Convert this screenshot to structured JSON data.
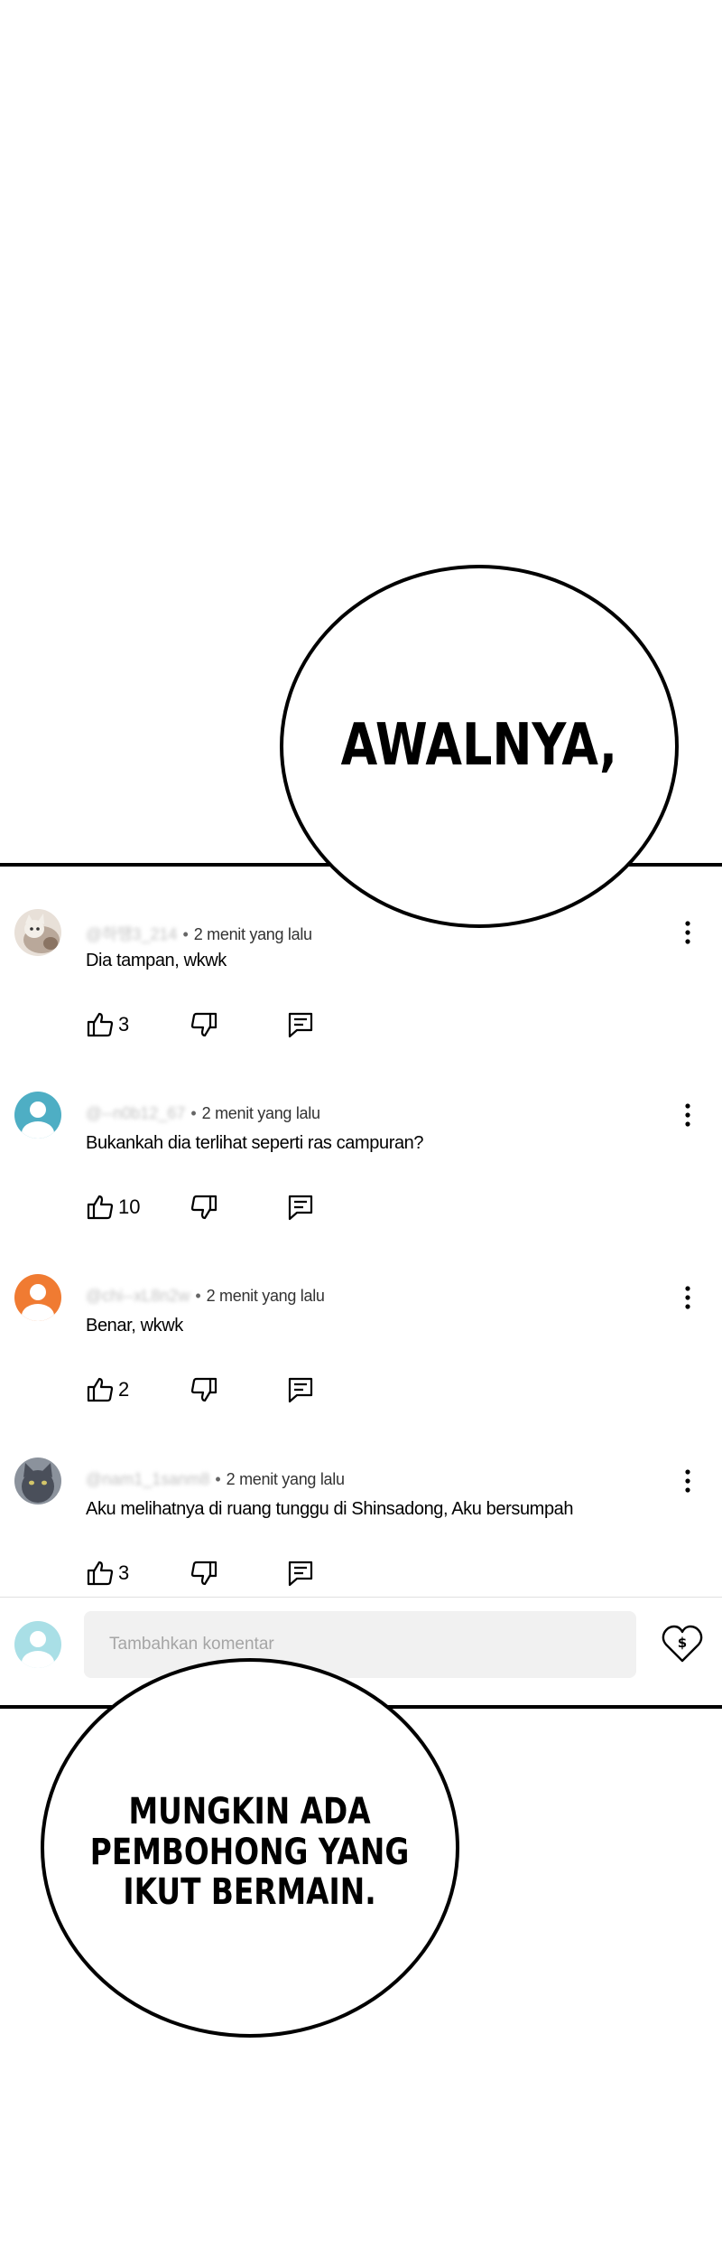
{
  "panel_top": {
    "bubble_text": "AWALNYA,"
  },
  "comments": [
    {
      "user": "@하땡3_214",
      "time": "2 menit yang lalu",
      "text": "Dia tampan, wkwk",
      "likes": "3",
      "avatar_color": "#b9a89a"
    },
    {
      "user": "@--n0b12_67",
      "time": "2 menit yang lalu",
      "text": "Bukankah dia terlihat seperti ras campuran?",
      "likes": "10",
      "avatar_color": "#4eaec4"
    },
    {
      "user": "@chi--xL8n2w",
      "time": "2 menit yang lalu",
      "text": "Benar, wkwk",
      "likes": "2",
      "avatar_color": "#f07b32"
    },
    {
      "user": "@nam1_1sanm8",
      "time": "2 menit yang lalu",
      "text": "Aku melihatnya di ruang tunggu di Shinsadong, Aku bersumpah",
      "likes": "3",
      "avatar_color": "#4a4f5a"
    }
  ],
  "comment_input": {
    "placeholder": "Tambahkan komentar",
    "avatar_color": "#a9dfe6"
  },
  "panel_bottom": {
    "bubble_text": "MUNGKIN ADA\nPEMBOHONG YANG\nIKUT BERMAIN."
  },
  "icons": {
    "like": "thumb-up-icon",
    "dislike": "thumb-down-icon",
    "reply": "reply-icon",
    "menu": "kebab-menu-icon",
    "tip": "heart-dollar-icon"
  }
}
